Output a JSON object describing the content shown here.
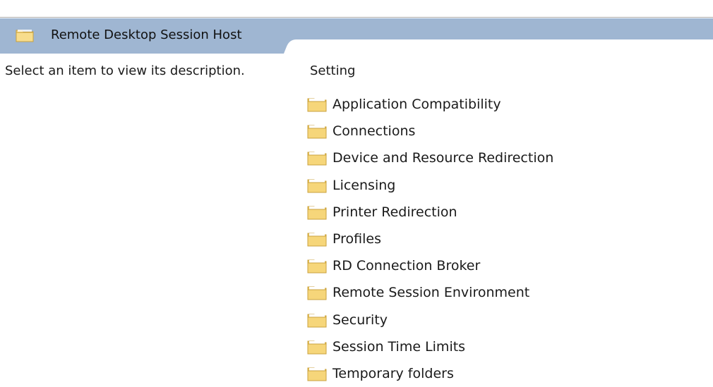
{
  "header": {
    "title": "Remote Desktop Session Host",
    "icon": "folder-icon"
  },
  "description": {
    "text": "Select an item to view its description."
  },
  "settings": {
    "column_header": "Setting",
    "items": [
      {
        "label": "Application Compatibility",
        "icon": "folder-icon"
      },
      {
        "label": "Connections",
        "icon": "folder-icon"
      },
      {
        "label": "Device and Resource Redirection",
        "icon": "folder-icon"
      },
      {
        "label": "Licensing",
        "icon": "folder-icon"
      },
      {
        "label": "Printer Redirection",
        "icon": "folder-icon"
      },
      {
        "label": "Profiles",
        "icon": "folder-icon"
      },
      {
        "label": "RD Connection Broker",
        "icon": "folder-icon"
      },
      {
        "label": "Remote Session Environment",
        "icon": "folder-icon"
      },
      {
        "label": "Security",
        "icon": "folder-icon"
      },
      {
        "label": "Session Time Limits",
        "icon": "folder-icon"
      },
      {
        "label": "Temporary folders",
        "icon": "folder-icon"
      }
    ]
  },
  "colors": {
    "header_background": "#9fb6d2",
    "folder_fill": "#f6d67a",
    "folder_tab": "#e8c25a",
    "folder_outline": "#c9a23f"
  }
}
